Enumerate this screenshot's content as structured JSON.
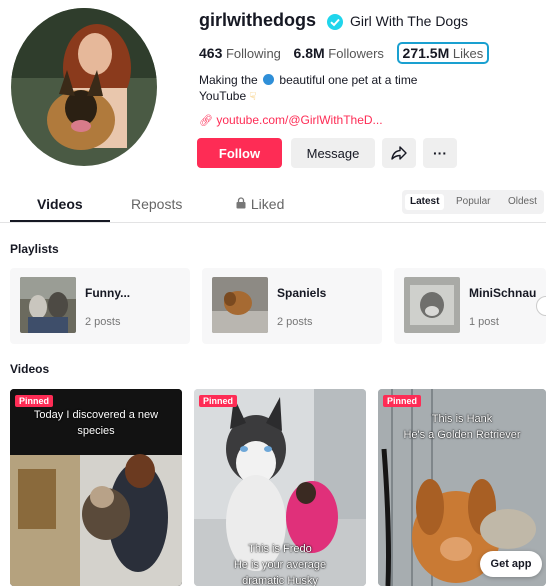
{
  "profile": {
    "handle": "girlwithedogs",
    "display_name": "Girl With The Dogs",
    "following_count": "463",
    "following_label": "Following",
    "followers_count": "6.8M",
    "followers_label": "Followers",
    "likes_count": "271.5M",
    "likes_label": "Likes",
    "bio_prefix": "Making the",
    "bio_suffix": "beautiful one pet at a time",
    "bio_line2": "YouTube",
    "link": "youtube.com/@GirlWithTheD..."
  },
  "actions": {
    "follow": "Follow",
    "message": "Message",
    "share_icon": "share-arrow-icon",
    "more": "···"
  },
  "tabs": {
    "videos": "Videos",
    "reposts": "Reposts",
    "liked": "Liked"
  },
  "sort": {
    "latest": "Latest",
    "popular": "Popular",
    "oldest": "Oldest"
  },
  "playlists": {
    "title": "Playlists",
    "items": [
      {
        "title": "Funny...",
        "count": "2 posts"
      },
      {
        "title": "Spaniels",
        "count": "2 posts"
      },
      {
        "title": "MiniSchnau",
        "count": "1 post"
      }
    ]
  },
  "videos": {
    "title": "Videos",
    "pinned": "Pinned",
    "items": [
      {
        "caption_top_1": "Today I discovered a new",
        "caption_top_2": "species"
      },
      {
        "caption_bottom_1": "This is Fredo",
        "caption_bottom_2": "He is your average",
        "caption_bottom_3": "dramatic Husky"
      },
      {
        "caption_top_1": "This is Hank",
        "caption_top_2": "He's a Golden Retriever"
      }
    ]
  },
  "get_app": "Get app",
  "colors": {
    "accent": "#fe2c55",
    "likes_highlight": "#1aa0d0",
    "verified": "#20d5ec"
  }
}
